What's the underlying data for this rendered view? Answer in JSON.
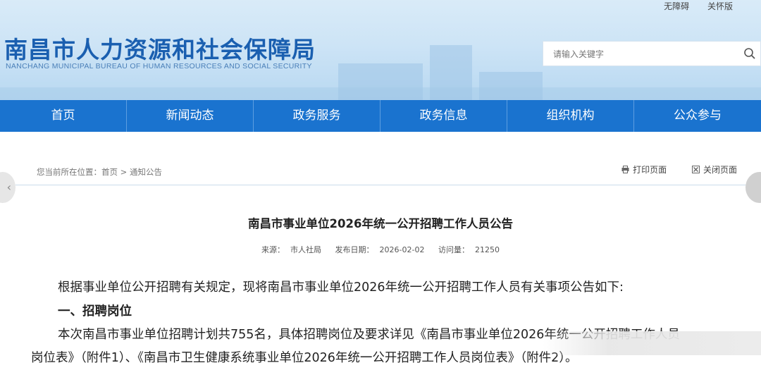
{
  "header": {
    "top_links": [
      "无障碍",
      "关怀版"
    ],
    "site_title": "南昌市人力资源和社会保障局",
    "site_subtitle": "NANCHANG MUNICIPAL BUREAU OF HUMAN RESOURCES AND SOCIAL SECURITY",
    "search": {
      "placeholder": "请输入关键字"
    }
  },
  "nav": {
    "items": [
      "首页",
      "新闻动态",
      "政务服务",
      "政务信息",
      "组织机构",
      "公众参与"
    ]
  },
  "breadcrumb": {
    "prefix": "您当前所在位置：",
    "home": "首页",
    "separator": ">",
    "current": "通知公告"
  },
  "tools": {
    "print": "打印页面",
    "close": "关闭页面"
  },
  "article": {
    "title": "南昌市事业单位2026年统一公开招聘工作人员公告",
    "source_label": "来源：",
    "source": "市人社局",
    "date_label": "发布日期：",
    "date": "2026-02-02",
    "visits_label": "访问量：",
    "visits": "21250",
    "para1": "根据事业单位公开招聘有关规定，现将南昌市事业单位2026年统一公开招聘工作人员有关事项公告如下:",
    "heading1": "一、招聘岗位",
    "para2_line1": "本次南昌市事业单位招聘计划共755名，具体招聘岗位及要求详见《南昌市事业单位2026年统一公开招聘工作人员",
    "para2_line2": "岗位表》（附件1）、《南昌市卫生健康系统事业单位2026年统一公开招聘工作人员岗位表》（附件2）。"
  },
  "colors": {
    "nav": "#1a73cf",
    "title": "#1a5fb0"
  }
}
